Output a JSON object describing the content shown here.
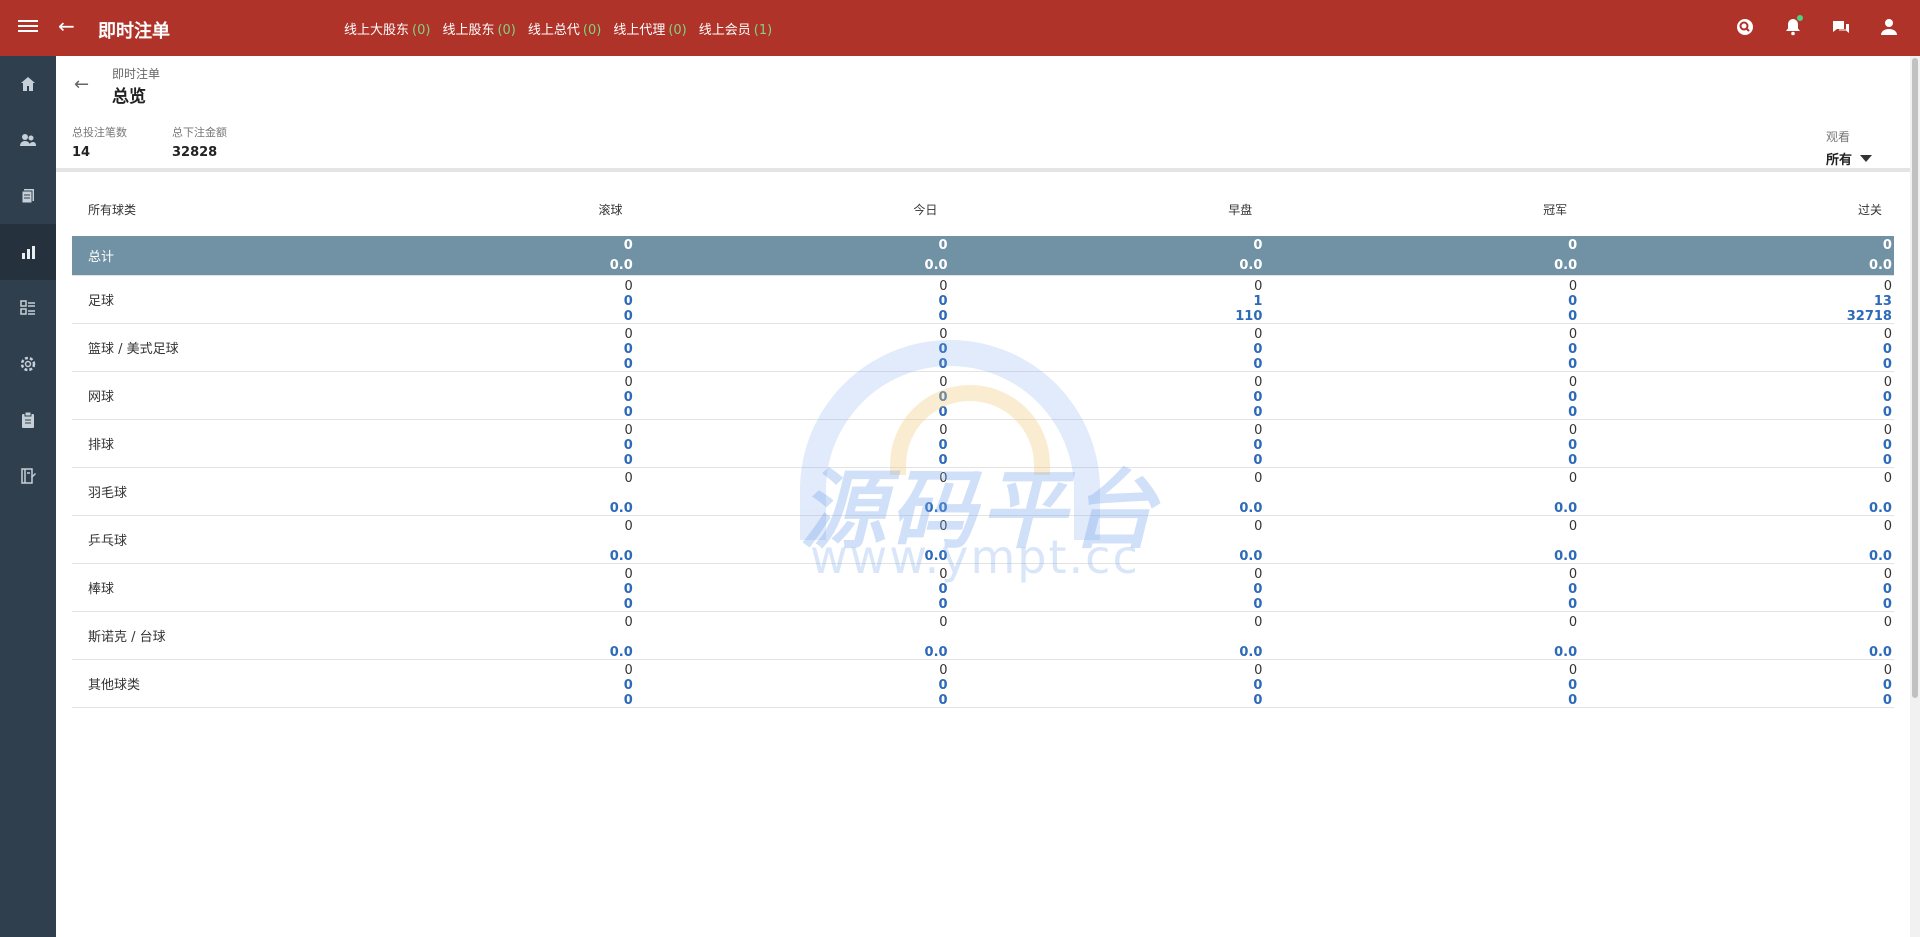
{
  "header": {
    "title": "即时注单",
    "online": [
      {
        "label": "线上大股东",
        "count": "(0)"
      },
      {
        "label": "线上股东",
        "count": "(0)"
      },
      {
        "label": "线上总代",
        "count": "(0)"
      },
      {
        "label": "线上代理",
        "count": "(0)"
      },
      {
        "label": "线上会员",
        "count": "(1)"
      }
    ],
    "icons": [
      "search-icon",
      "bell-icon",
      "chat-icon",
      "user-icon"
    ]
  },
  "sidebar": {
    "items": [
      "home-icon",
      "users-icon",
      "documents-icon",
      "chart-icon",
      "list-icon",
      "settings-icon",
      "clipboard-icon",
      "report-icon"
    ],
    "active_index": 3
  },
  "page": {
    "breadcrumb": "即时注单",
    "title": "总览",
    "total_bets_label": "总投注笔数",
    "total_bets": "14",
    "total_amount_label": "总下注金额",
    "total_amount": "32828",
    "view_label": "观看",
    "view_value": "所有"
  },
  "table": {
    "columns": [
      "所有球类",
      "滚球",
      "今日",
      "早盘",
      "冠军",
      "过关"
    ],
    "total": {
      "label": "总计",
      "cells": [
        [
          "0",
          "0.0"
        ],
        [
          "0",
          "0.0"
        ],
        [
          "0",
          "0.0"
        ],
        [
          "0",
          "0.0"
        ],
        [
          "0",
          "0.0"
        ]
      ]
    },
    "rows": [
      {
        "label": "足球",
        "cells": [
          [
            "0",
            "0",
            "0"
          ],
          [
            "0",
            "0",
            "0"
          ],
          [
            "0",
            "1",
            "110"
          ],
          [
            "0",
            "0",
            "0"
          ],
          [
            "0",
            "13",
            "32718"
          ]
        ]
      },
      {
        "label": "篮球 / 美式足球",
        "cells": [
          [
            "0",
            "0",
            "0"
          ],
          [
            "0",
            "0",
            "0"
          ],
          [
            "0",
            "0",
            "0"
          ],
          [
            "0",
            "0",
            "0"
          ],
          [
            "0",
            "0",
            "0"
          ]
        ]
      },
      {
        "label": "网球",
        "cells": [
          [
            "0",
            "0",
            "0"
          ],
          [
            "0",
            "0",
            "0"
          ],
          [
            "0",
            "0",
            "0"
          ],
          [
            "0",
            "0",
            "0"
          ],
          [
            "0",
            "0",
            "0"
          ]
        ]
      },
      {
        "label": "排球",
        "cells": [
          [
            "0",
            "0",
            "0"
          ],
          [
            "0",
            "0",
            "0"
          ],
          [
            "0",
            "0",
            "0"
          ],
          [
            "0",
            "0",
            "0"
          ],
          [
            "0",
            "0",
            "0"
          ]
        ]
      },
      {
        "label": "羽毛球",
        "cells": [
          [
            "0",
            "",
            "0.0"
          ],
          [
            "0",
            "",
            "0.0"
          ],
          [
            "0",
            "",
            "0.0"
          ],
          [
            "0",
            "",
            "0.0"
          ],
          [
            "0",
            "",
            "0.0"
          ]
        ]
      },
      {
        "label": "乒乓球",
        "cells": [
          [
            "0",
            "",
            "0.0"
          ],
          [
            "0",
            "",
            "0.0"
          ],
          [
            "0",
            "",
            "0.0"
          ],
          [
            "0",
            "",
            "0.0"
          ],
          [
            "0",
            "",
            "0.0"
          ]
        ]
      },
      {
        "label": "棒球",
        "cells": [
          [
            "0",
            "0",
            "0"
          ],
          [
            "0",
            "0",
            "0"
          ],
          [
            "0",
            "0",
            "0"
          ],
          [
            "0",
            "0",
            "0"
          ],
          [
            "0",
            "0",
            "0"
          ]
        ]
      },
      {
        "label": "斯诺克 / 台球",
        "cells": [
          [
            "0",
            "",
            "0.0"
          ],
          [
            "0",
            "",
            "0.0"
          ],
          [
            "0",
            "",
            "0.0"
          ],
          [
            "0",
            "",
            "0.0"
          ],
          [
            "0",
            "",
            "0.0"
          ]
        ]
      },
      {
        "label": "其他球类",
        "cells": [
          [
            "0",
            "0",
            "0"
          ],
          [
            "0",
            "0",
            "0"
          ],
          [
            "0",
            "0",
            "0"
          ],
          [
            "0",
            "0",
            "0"
          ],
          [
            "0",
            "0",
            "0"
          ]
        ]
      }
    ]
  },
  "watermark": {
    "text": "源码平台",
    "url": "www.ympt.cc"
  }
}
